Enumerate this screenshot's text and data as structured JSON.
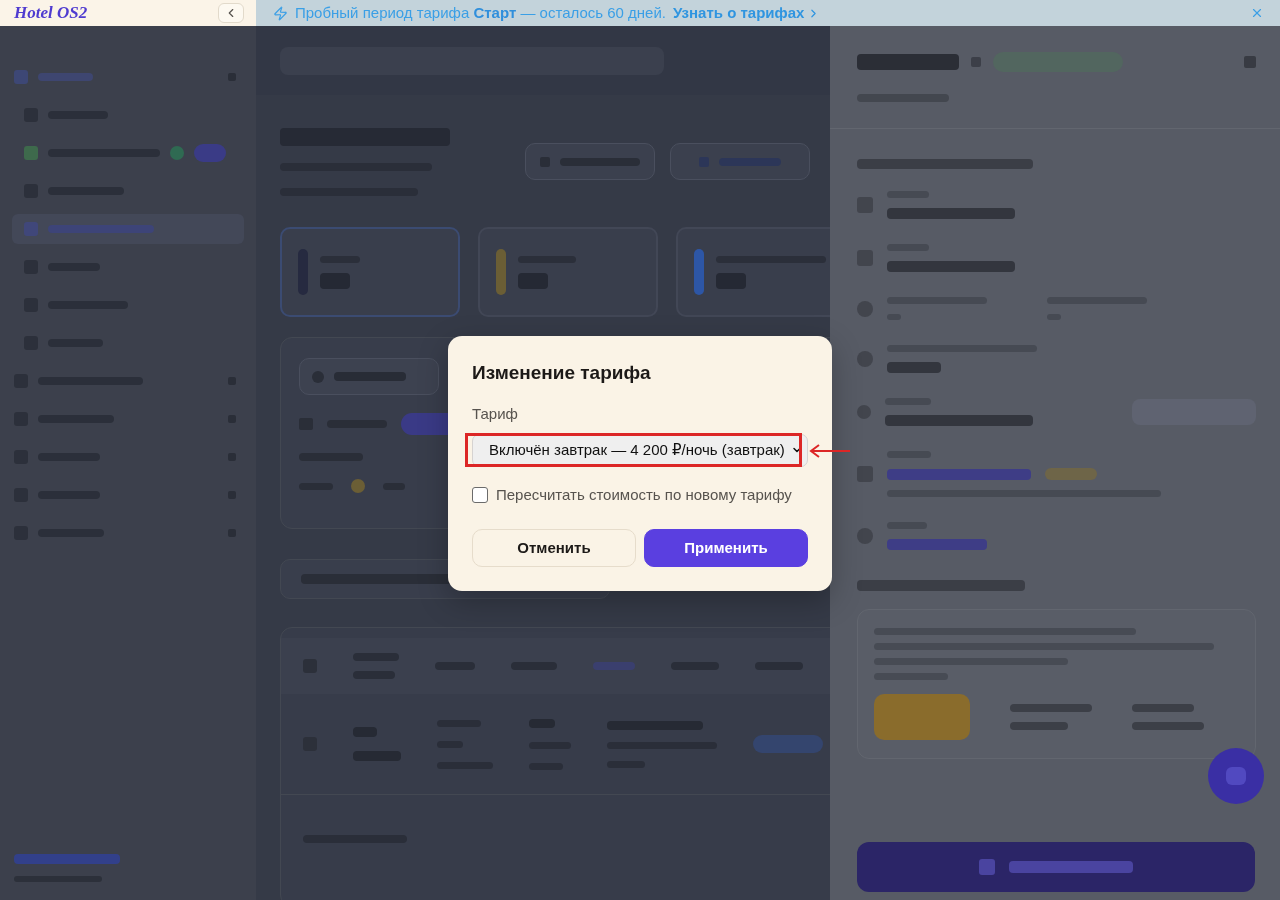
{
  "sidebar": {
    "logo": "Hotel OS2"
  },
  "banner": {
    "message": "Пробный период тарифа **Старт** — осталось 60 дней.",
    "link": "Узнать о тарифах"
  },
  "dialog": {
    "title": "Изменение тарифа",
    "field_label": "Тариф",
    "select_value": "Включён завтрак — 4 200 ₽/ночь (завтрак)",
    "select_highlighted": true,
    "checkbox": {
      "label": "Пересчитать стоимость по новому тарифу",
      "checked": false
    },
    "buttons": [
      {
        "label": "Отменить",
        "kind": "secondary"
      },
      {
        "label": "Применить",
        "kind": "primary"
      }
    ]
  }
}
